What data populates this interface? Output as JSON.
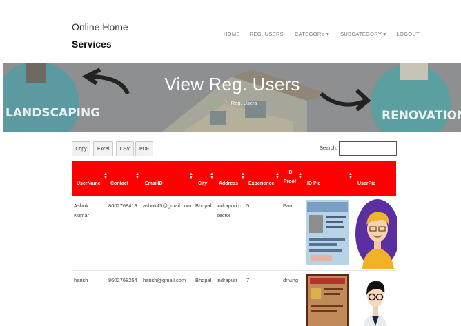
{
  "brand": {
    "line1": "Online Home",
    "line2": "Services"
  },
  "nav": [
    "HOME",
    "REG. USERS",
    "CATEGORY ▾",
    "SUBCATEGORY ▾",
    "LOGOUT"
  ],
  "banner": {
    "title": "View Reg. Users",
    "crumb_home": "Home",
    "crumb_current": "Reg. Users",
    "left_sign": "LANDSCAPING",
    "right_sign": "RENOVATION"
  },
  "export_buttons": [
    "Copy",
    "Excel",
    "CSV",
    "PDF"
  ],
  "search": {
    "label": "Search:",
    "value": ""
  },
  "table": {
    "columns": [
      "UserName",
      "Contact",
      "EmailID",
      "City",
      "Address",
      "Experience",
      "ID Proof",
      "ID Pic",
      "UserPic"
    ],
    "rows": [
      {
        "username": "Ashok Kumar",
        "contact": "8602768413",
        "email": "ashok45@gmail.com",
        "city": "Bhopal",
        "address": "indrapuri c sector",
        "experience": "5",
        "id_proof": "Pan"
      },
      {
        "username": "harish",
        "contact": "8602768254",
        "email": "harish@gmail.com",
        "city": "Bhopal",
        "address": "indrapuri",
        "experience": "7",
        "id_proof": "driving"
      }
    ]
  },
  "colors": {
    "header_red": "#ff0000",
    "crumb_green": "#7cc36b"
  }
}
